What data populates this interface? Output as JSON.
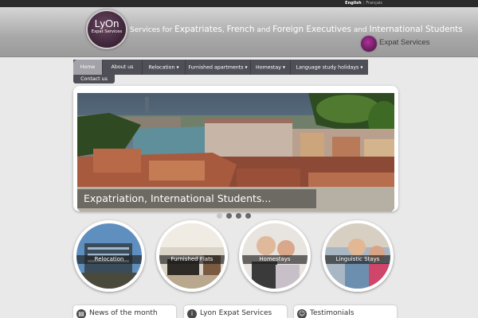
{
  "topbar": {
    "lang_active": "English",
    "lang_other": "Français"
  },
  "header": {
    "logo_line1": "LyOn",
    "logo_line2": "Expat Services",
    "tagline": [
      {
        "text": "Services for ",
        "em": false
      },
      {
        "text": "Expatriates",
        "em": true
      },
      {
        "text": ", ",
        "em": false
      },
      {
        "text": "French",
        "em": true
      },
      {
        "text": " and ",
        "em": false
      },
      {
        "text": "Foreign Executives",
        "em": true
      },
      {
        "text": " and ",
        "em": false
      },
      {
        "text": "International Students",
        "em": true
      }
    ],
    "badge_text": "Expat Services"
  },
  "nav": {
    "items": [
      {
        "label": "Home",
        "dropdown": false
      },
      {
        "label": "About us",
        "dropdown": false
      },
      {
        "label": "Relocation",
        "dropdown": true
      },
      {
        "label": "Furnished apartments",
        "dropdown": true
      },
      {
        "label": "Homestay",
        "dropdown": true
      },
      {
        "label": "Language study holidays",
        "dropdown": true
      }
    ],
    "contact": "Contact us"
  },
  "slider": {
    "caption": "Expatriation, International Students...",
    "dot_count": 4,
    "active_dot": 0
  },
  "circles": [
    {
      "label": "Relocation"
    },
    {
      "label": "Furnished Flats"
    },
    {
      "label": "Homestays"
    },
    {
      "label": "Linguistic Stays"
    }
  ],
  "boxes": [
    {
      "title": "News of the month",
      "icon": "news-icon"
    },
    {
      "title": "Lyon Expat Services",
      "icon": "info-icon"
    },
    {
      "title": "Testimonials",
      "icon": "people-icon"
    }
  ],
  "colors": {
    "nav_bg": "#4f4f57",
    "nav_active": "#a2a2a8",
    "brand": "#5c2a52"
  }
}
